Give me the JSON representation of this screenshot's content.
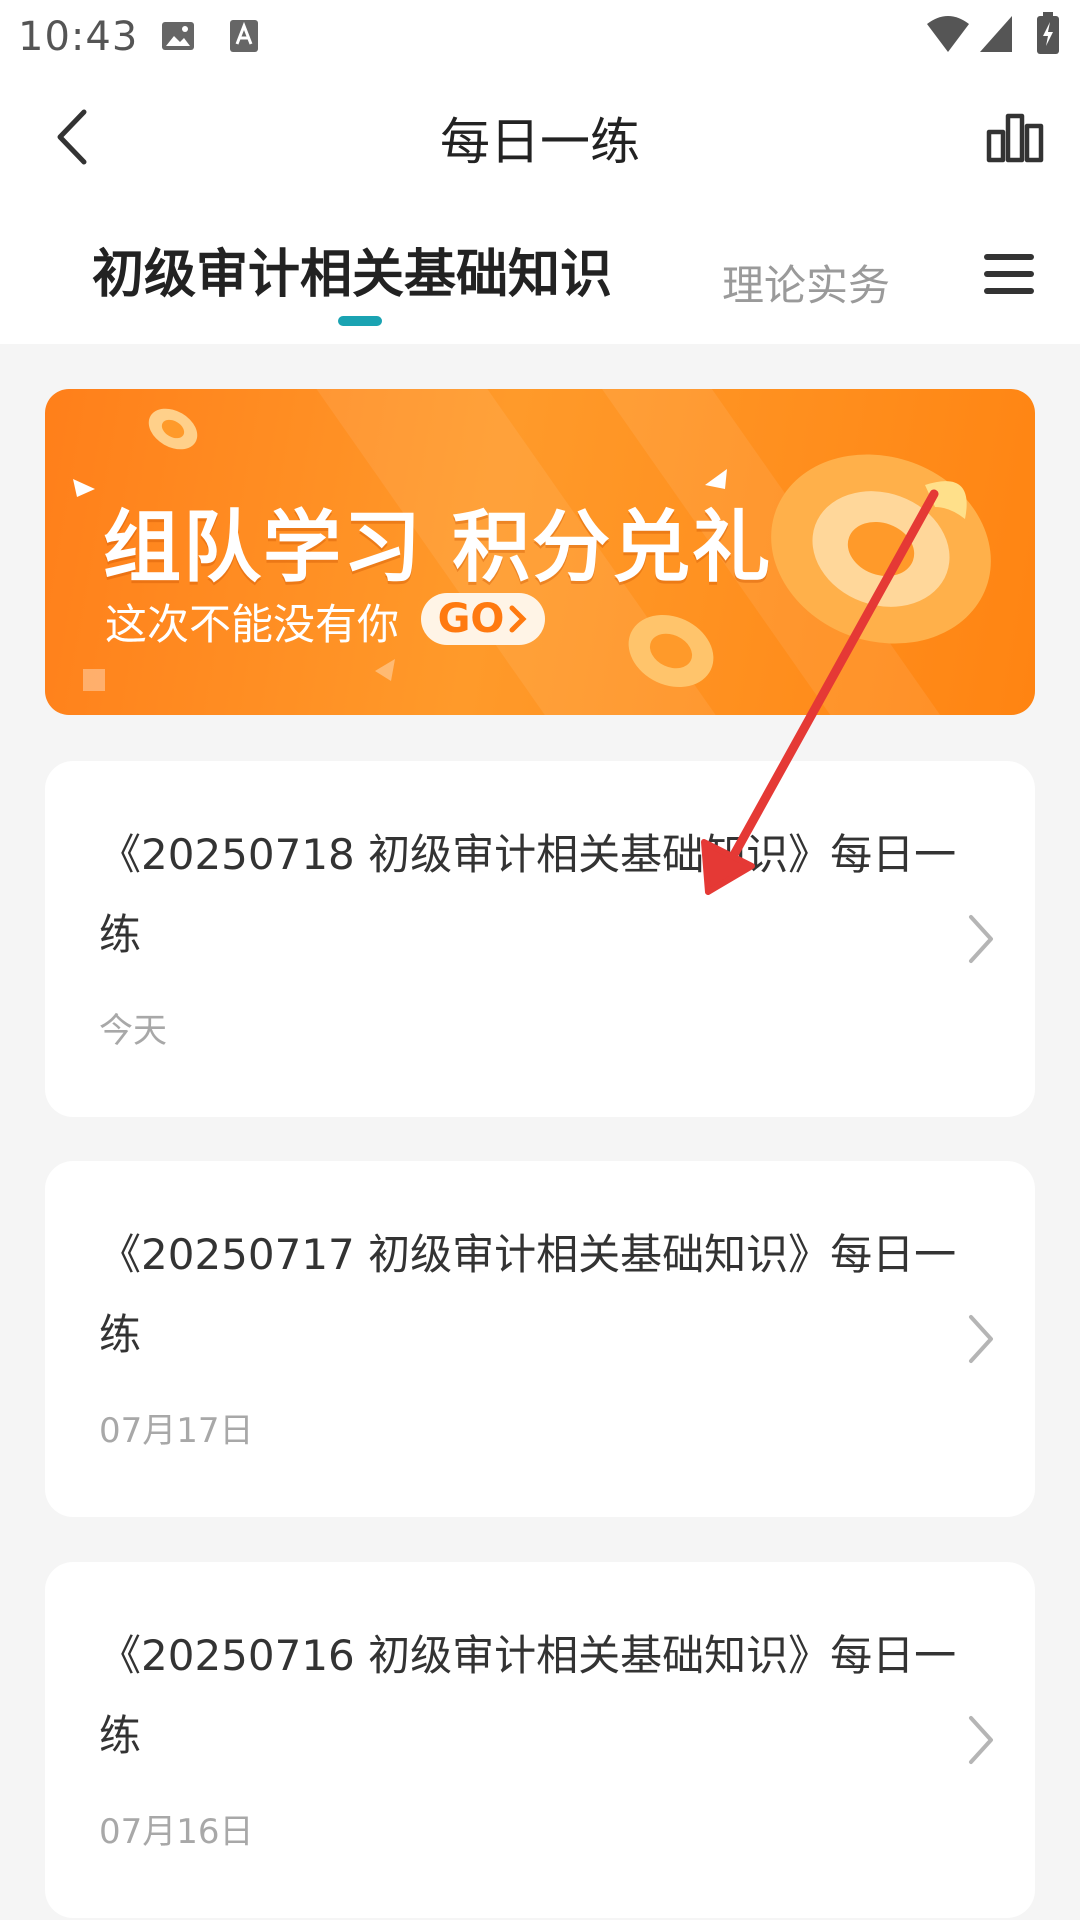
{
  "status_bar": {
    "time": "10:43",
    "icons": [
      "image-notification-icon",
      "font-notification-icon",
      "wifi-icon",
      "cellular-signal-icon",
      "battery-charging-icon"
    ]
  },
  "header": {
    "title": "每日一练",
    "back_icon": "chevron-left-icon",
    "stats_icon": "bar-chart-icon"
  },
  "tabs": {
    "items": [
      {
        "label": "初级审计相关基础知识",
        "active": true
      },
      {
        "label": "理论实务",
        "active": false
      }
    ],
    "menu_icon": "hamburger-menu-icon",
    "accent": "#1aa3b2"
  },
  "banner": {
    "title": "组队学习 积分兑礼",
    "subtitle": "这次不能没有你",
    "go_label": "GO",
    "colors": {
      "start": "#ff7f1a",
      "end": "#ff8412"
    }
  },
  "cards": [
    {
      "title": "《20250718 初级审计相关基础知识》每日一练",
      "date": "今天"
    },
    {
      "title": "《20250717 初级审计相关基础知识》每日一练",
      "date": "07月17日"
    },
    {
      "title": "《20250716 初级审计相关基础知识》每日一练",
      "date": "07月16日"
    }
  ],
  "annotation": {
    "arrow_color": "#e53935"
  }
}
